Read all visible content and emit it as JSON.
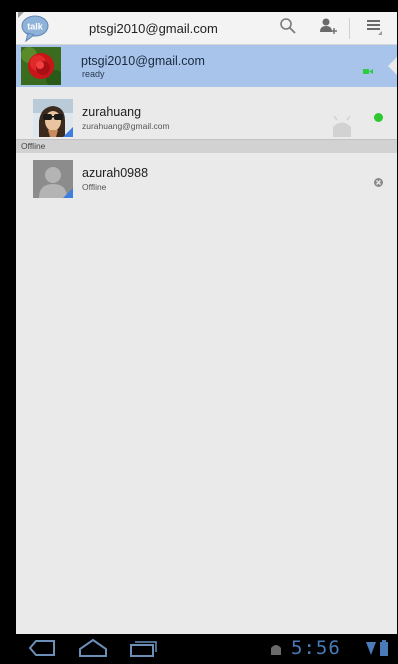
{
  "app": {
    "account_title": "ptsgi2010@gmail.com",
    "logo_text": "talk"
  },
  "action_bar": {
    "icons": [
      "search-icon",
      "add-contact-icon",
      "menu-icon"
    ]
  },
  "self": {
    "name": "ptsgi2010@gmail.com",
    "status": "ready",
    "video_available": true,
    "colors": {
      "row_bg": "#a8c4ea",
      "video": "#2ecc40"
    }
  },
  "contacts": [
    {
      "name": "zurahuang",
      "sub": "zurahuang@gmail.com",
      "presence": "available",
      "presence_color": "#2dc82d"
    }
  ],
  "offline_section": {
    "label": "Offline",
    "contacts": [
      {
        "name": "azurah0988",
        "sub": "Offline",
        "presence": "offline",
        "presence_color": "#8a8a8a"
      }
    ]
  },
  "system_bar": {
    "time": "5:56",
    "icons": [
      "back-icon",
      "home-icon",
      "recent-apps-icon",
      "android-debug-icon",
      "wifi-icon",
      "battery-icon"
    ]
  }
}
